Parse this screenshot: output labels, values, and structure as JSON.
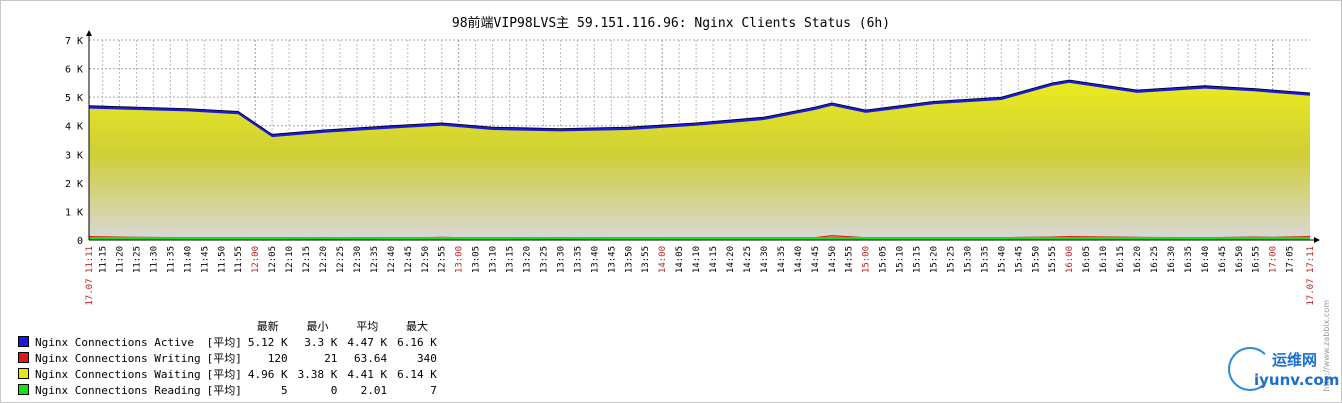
{
  "chart_data": {
    "type": "area",
    "title": "98前端VIP98LVS主 59.151.116.96: Nginx Clients Status (6h)",
    "ylim": [
      0,
      7000
    ],
    "y_ticks": [
      "0",
      "1 K",
      "2 K",
      "3 K",
      "4 K",
      "5 K",
      "6 K",
      "7 K"
    ],
    "x_start_label": "17.07 11:11",
    "x_end_label": "17.07 17:11",
    "x_ticks": [
      "11:15",
      "11:20",
      "11:25",
      "11:30",
      "11:35",
      "11:40",
      "11:45",
      "11:50",
      "11:55",
      "12:00",
      "12:05",
      "12:10",
      "12:15",
      "12:20",
      "12:25",
      "12:30",
      "12:35",
      "12:40",
      "12:45",
      "12:50",
      "12:55",
      "13:00",
      "13:05",
      "13:10",
      "13:15",
      "13:20",
      "13:25",
      "13:30",
      "13:35",
      "13:40",
      "13:45",
      "13:50",
      "13:55",
      "14:00",
      "14:05",
      "14:10",
      "14:15",
      "14:20",
      "14:25",
      "14:30",
      "14:35",
      "14:40",
      "14:45",
      "14:50",
      "14:55",
      "15:00",
      "15:05",
      "15:10",
      "15:15",
      "15:20",
      "15:25",
      "15:30",
      "15:35",
      "15:40",
      "15:45",
      "15:50",
      "15:55",
      "16:00",
      "16:05",
      "16:10",
      "16:15",
      "16:20",
      "16:25",
      "16:30",
      "16:35",
      "16:40",
      "16:45",
      "16:50",
      "16:55",
      "17:00",
      "17:05"
    ],
    "x_hours": [
      "12:00",
      "13:00",
      "14:00",
      "15:00",
      "16:00",
      "17:00"
    ],
    "x": [
      "11:11",
      "11:25",
      "11:40",
      "11:55",
      "12:05",
      "12:20",
      "12:40",
      "12:55",
      "13:10",
      "13:30",
      "13:50",
      "14:10",
      "14:30",
      "14:45",
      "14:50",
      "15:00",
      "15:20",
      "15:40",
      "15:55",
      "16:00",
      "16:20",
      "16:40",
      "16:55",
      "17:00",
      "17:11"
    ],
    "series": [
      {
        "name": "Nginx Connections Active",
        "color": "#1a1adc",
        "values": [
          4700,
          4650,
          4600,
          4500,
          3700,
          3850,
          4000,
          4100,
          3950,
          3900,
          3950,
          4100,
          4300,
          4650,
          4800,
          4550,
          4850,
          5000,
          5500,
          5600,
          5250,
          5400,
          5300,
          5250,
          5150
        ]
      },
      {
        "name": "Nginx Connections Waiting",
        "color": "#e6e61e",
        "values": [
          4600,
          4550,
          4500,
          4400,
          3600,
          3750,
          3900,
          4000,
          3850,
          3800,
          3850,
          4000,
          4200,
          4550,
          4700,
          4450,
          4750,
          4900,
          5400,
          5500,
          5150,
          5300,
          5200,
          5150,
          5050
        ]
      },
      {
        "name": "Nginx Connections Writing",
        "color": "#dc1a1a",
        "values": [
          120,
          90,
          80,
          70,
          60,
          50,
          60,
          90,
          60,
          50,
          60,
          60,
          70,
          80,
          150,
          80,
          70,
          80,
          100,
          120,
          90,
          80,
          100,
          90,
          120
        ]
      },
      {
        "name": "Nginx Connections Reading",
        "color": "#1adc1a",
        "values": [
          5,
          3,
          2,
          2,
          2,
          1,
          2,
          3,
          2,
          2,
          2,
          2,
          2,
          2,
          3,
          2,
          2,
          2,
          3,
          3,
          2,
          2,
          2,
          2,
          5
        ]
      }
    ]
  },
  "legend": {
    "headers": {
      "last": "最新",
      "min": "最小",
      "avg": "平均",
      "max": "最大"
    },
    "rows": [
      {
        "name": "Nginx Connections Active",
        "color": "#1a1adc",
        "func": "[平均]",
        "last": "5.12 K",
        "min": "3.3 K",
        "avg": "4.47 K",
        "max": "6.16 K"
      },
      {
        "name": "Nginx Connections Writing",
        "color": "#dc1a1a",
        "func": "[平均]",
        "last": "120",
        "min": "21",
        "avg": "63.64",
        "max": "340"
      },
      {
        "name": "Nginx Connections Waiting",
        "color": "#e6e61e",
        "func": "[平均]",
        "last": "4.96 K",
        "min": "3.38 K",
        "avg": "4.41 K",
        "max": "6.14 K"
      },
      {
        "name": "Nginx Connections Reading",
        "color": "#1adc1a",
        "func": "[平均]",
        "last": "5",
        "min": "0",
        "avg": "2.01",
        "max": "7"
      }
    ]
  },
  "watermark": {
    "top": "运维网",
    "bottom": "iyunv.com"
  },
  "credit": "http://www.zabbix.com"
}
